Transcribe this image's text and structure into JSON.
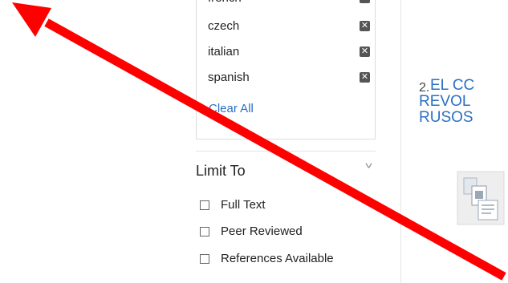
{
  "languages": {
    "items": [
      {
        "label": "french"
      },
      {
        "label": "czech"
      },
      {
        "label": "italian"
      },
      {
        "label": "spanish"
      }
    ],
    "remove_glyph": "✕",
    "clear_all": "Clear All"
  },
  "limit_to": {
    "title": "Limit To",
    "chevron": "˅",
    "options": [
      {
        "label": "Full Text",
        "checked": false
      },
      {
        "label": "Peer Reviewed",
        "checked": false
      },
      {
        "label": "References Available",
        "checked": false
      }
    ]
  },
  "result": {
    "number": "2.",
    "title_lines": [
      "EL CC",
      "REVOL",
      "RUSOS"
    ]
  },
  "colors": {
    "link": "#2b6fc2",
    "arrow": "#ff0000",
    "remove_button": "#555555"
  },
  "icons": {
    "arrow": "red-annotation-arrow",
    "remove": "close-icon",
    "document": "document-thumbnail-icon"
  }
}
